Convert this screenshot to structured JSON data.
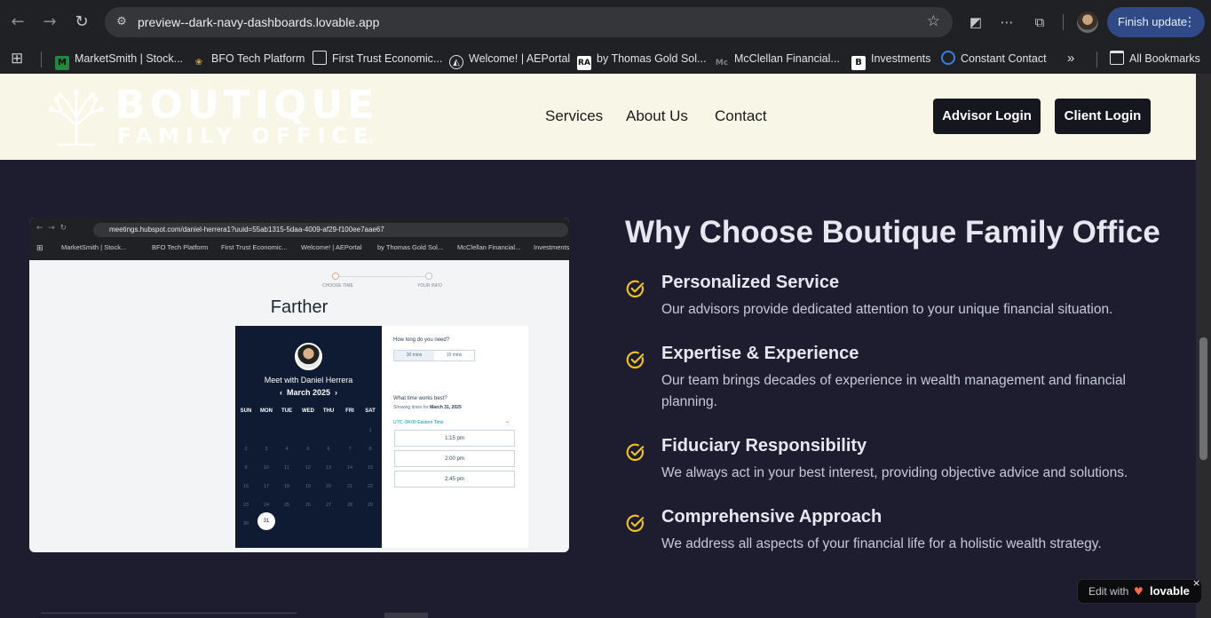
{
  "browser": {
    "url": "preview--dark-navy-dashboards.lovable.app",
    "finish_update": "Finish update",
    "bookmarks": [
      "MarketSmith | Stock...",
      "BFO Tech Platform",
      "First Trust Economic...",
      "Welcome! | AEPortal",
      "by Thomas Gold Sol...",
      "McClellan Financial...",
      "Investments",
      "Constant Contact"
    ],
    "bookmark_icons": [
      "M",
      "RA",
      "Mc",
      "B"
    ],
    "overflow": "»",
    "all_bookmarks": "All Bookmarks"
  },
  "site": {
    "logo_line1": "BOUTIQUE",
    "logo_line2": "FAMILY OFFICE",
    "logo_tm": "TM",
    "nav": [
      "Services",
      "About Us",
      "Contact"
    ],
    "advisor_login": "Advisor Login",
    "client_login": "Client Login"
  },
  "screenshot": {
    "url": "meetings.hubspot.com/daniel-herrera1?uuid=55ab1315-5daa-4009-af29-f100ee7aae67",
    "bookmarks": [
      "MarketSmith | Stock...",
      "BFO Tech Platform",
      "First Trust Economic...",
      "Welcome! | AEPortal",
      "by Thomas Gold Sol...",
      "McClellan Financial...",
      "Investments"
    ],
    "step1": "CHOOSE TIME",
    "step2": "YOUR INFO",
    "brand": "Farther",
    "meet_with": "Meet with Daniel Herrera",
    "month": "March 2025",
    "prev": "‹",
    "next": "›",
    "weekdays": [
      "SUN",
      "MON",
      "TUE",
      "WED",
      "THU",
      "FRI",
      "SAT"
    ],
    "days": [
      "1",
      "2",
      "3",
      "4",
      "5",
      "6",
      "7",
      "8",
      "9",
      "10",
      "11",
      "12",
      "13",
      "14",
      "15",
      "16",
      "17",
      "18",
      "19",
      "20",
      "21",
      "22",
      "23",
      "24",
      "25",
      "26",
      "27",
      "28",
      "29",
      "30",
      "31"
    ],
    "selected_day": "31",
    "how_long": "How long do you need?",
    "duration_options": [
      "30 mins",
      "15 mins"
    ],
    "what_time": "What time works best?",
    "showing_prefix": "Showing times for",
    "showing_date": "March 31, 2025",
    "timezone": "UTC -04:00 Eastern Time",
    "timezone_caret": "⌄",
    "slots": [
      "1:15 pm",
      "2:00 pm",
      "2:45 pm"
    ]
  },
  "why": {
    "title": "Why Choose Boutique Family Office",
    "features": [
      {
        "title": "Personalized Service",
        "desc": "Our advisors provide dedicated attention to your unique financial situation."
      },
      {
        "title": "Expertise & Experience",
        "desc": "Our team brings decades of experience in wealth management and financial planning."
      },
      {
        "title": "Fiduciary Responsibility",
        "desc": "We always act in your best interest, providing objective advice and solutions."
      },
      {
        "title": "Comprehensive Approach",
        "desc": "We address all aspects of your financial life for a holistic wealth strategy."
      }
    ]
  },
  "lovable": {
    "edit_with": "Edit with",
    "brand": "lovable",
    "close": "×"
  },
  "colors": {
    "accent": "#f5c518",
    "navy": "#1e1d30",
    "header_bg": "#f8f6e6",
    "button_dark": "#16161f"
  }
}
